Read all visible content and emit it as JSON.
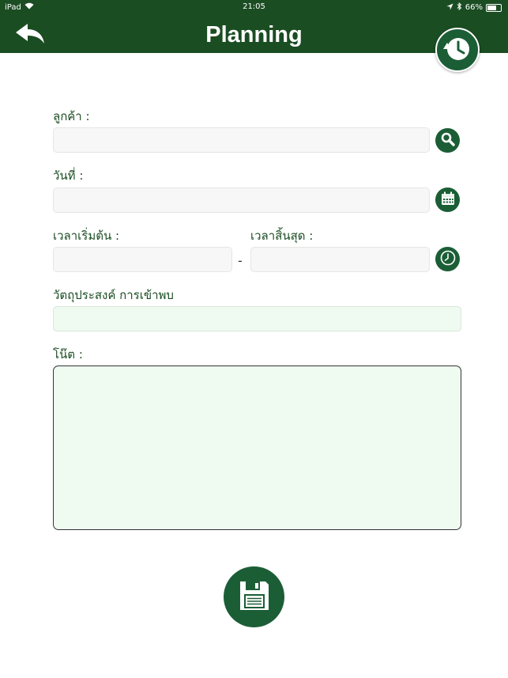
{
  "status_bar": {
    "device": "iPad",
    "time": "21:05",
    "battery": "66%",
    "battery_level": 0.66
  },
  "header": {
    "title": "Planning"
  },
  "form": {
    "customer_label": "ลูกค้า :",
    "customer_value": "",
    "date_label": "วันที่ :",
    "date_value": "",
    "start_time_label": "เวลาเริ่มต้น :",
    "start_time_value": "",
    "end_time_label": "เวลาสิ้นสุด :",
    "end_time_value": "",
    "time_separator": "-",
    "purpose_label": "วัตถุประสงค์ การเข้าพบ",
    "purpose_value": "",
    "note_label": "โน๊ต :",
    "note_value": ""
  },
  "icons": {
    "back": "back-arrow-icon",
    "history": "history-icon",
    "search": "search-icon",
    "calendar": "calendar-icon",
    "clock": "clock-icon",
    "save": "floppy-disk-icon"
  },
  "colors": {
    "header_bg": "#1b4d23",
    "accent": "#1b5e36",
    "label": "#1b4d23",
    "field_green": "#effaf0"
  }
}
